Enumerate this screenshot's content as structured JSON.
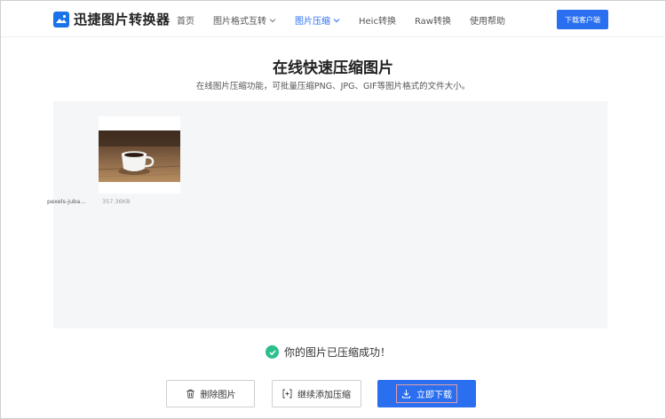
{
  "header": {
    "brand": "迅捷图片转换器",
    "nav": [
      {
        "label": "首页",
        "dropdown": false,
        "active": false
      },
      {
        "label": "图片格式互转",
        "dropdown": true,
        "active": false
      },
      {
        "label": "图片压缩",
        "dropdown": true,
        "active": true
      },
      {
        "label": "Heic转换",
        "dropdown": false,
        "active": false
      },
      {
        "label": "Raw转换",
        "dropdown": false,
        "active": false
      },
      {
        "label": "使用帮助",
        "dropdown": false,
        "active": false
      }
    ],
    "download_client": "下载客户端"
  },
  "main": {
    "title": "在线快速压缩图片",
    "subtitle": "在线图片压缩功能，可批量压缩PNG、JPG、GIF等图片格式的文件大小。"
  },
  "file": {
    "name": "pexels-juba...",
    "size": "357.36KB"
  },
  "status": {
    "message": "你的图片已压缩成功！"
  },
  "actions": {
    "delete": "删除图片",
    "add_more": "继续添加压缩",
    "download": "立即下载"
  },
  "colors": {
    "accent": "#2a6ff0",
    "success": "#2bc08a",
    "workspace_bg": "#f5f6f8"
  }
}
